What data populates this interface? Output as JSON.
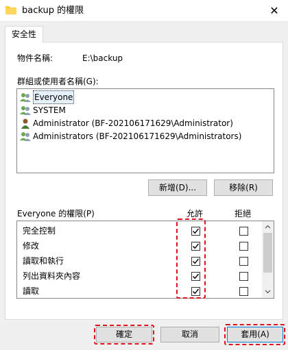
{
  "window": {
    "title": "backup 的權限",
    "close_glyph": "✕"
  },
  "tabs": [
    {
      "label": "安全性"
    }
  ],
  "object": {
    "label": "物件名稱:",
    "value": "E:\\backup"
  },
  "groups": {
    "label": "群組或使用者名稱(G):",
    "items": [
      {
        "name": "Everyone",
        "icon": "users-group-icon",
        "selected": true
      },
      {
        "name": "SYSTEM",
        "icon": "users-group-icon",
        "selected": false
      },
      {
        "name": "Administrator (BF-202106171629\\Administrator)",
        "icon": "user-icon",
        "selected": false
      },
      {
        "name": "Administrators (BF-202106171629\\Administrators)",
        "icon": "users-group-icon",
        "selected": false
      }
    ],
    "add_button": "新增(D)...",
    "remove_button": "移除(R)"
  },
  "permissions": {
    "label": "Everyone 的權限(P)",
    "allow_header": "允許",
    "deny_header": "拒絕",
    "rows": [
      {
        "name": "完全控制",
        "allow": true,
        "deny": false
      },
      {
        "name": "修改",
        "allow": true,
        "deny": false
      },
      {
        "name": "讀取和執行",
        "allow": true,
        "deny": false
      },
      {
        "name": "列出資料夾內容",
        "allow": true,
        "deny": false
      },
      {
        "name": "讀取",
        "allow": true,
        "deny": false
      }
    ]
  },
  "footer": {
    "ok": "確定",
    "cancel": "取消",
    "apply": "套用(A)"
  },
  "colors": {
    "highlight": "#e0101a",
    "dialog_bg": "#f0f0f0",
    "button_bg": "#e1e1e1"
  }
}
